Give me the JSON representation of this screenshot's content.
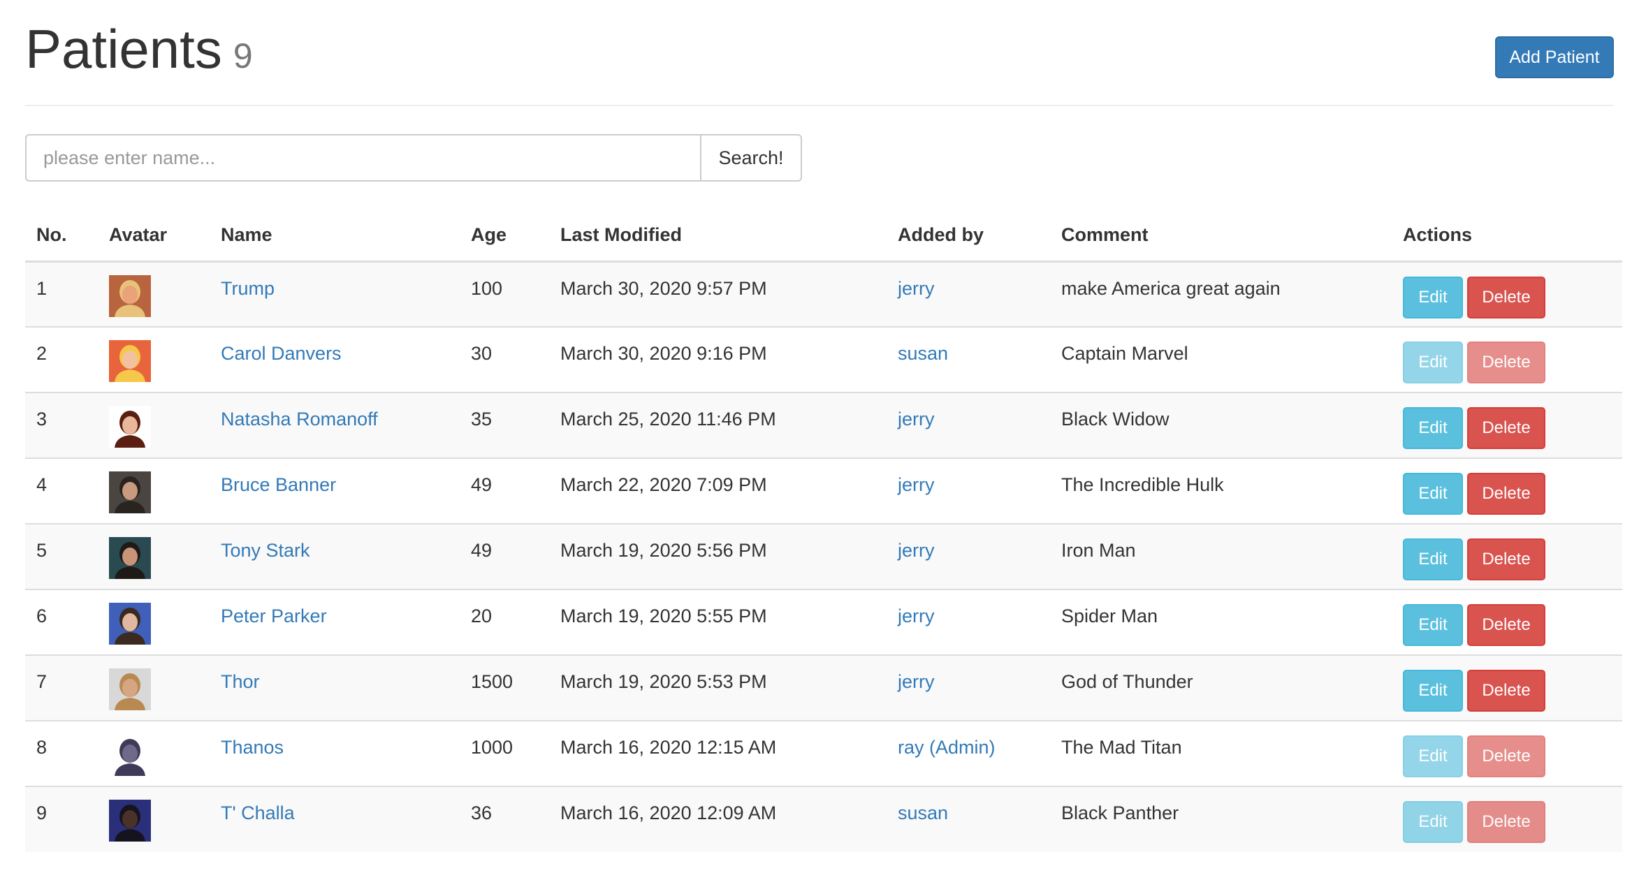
{
  "header": {
    "title": "Patients",
    "count": "9",
    "add_button": "Add Patient"
  },
  "search": {
    "placeholder": "please enter name...",
    "value": "",
    "button": "Search!"
  },
  "table": {
    "headers": [
      "No.",
      "Avatar",
      "Name",
      "Age",
      "Last Modified",
      "Added by",
      "Comment",
      "Actions"
    ],
    "edit_label": "Edit",
    "delete_label": "Delete",
    "rows": [
      {
        "no": "1",
        "name": "Trump",
        "age": "100",
        "modified": "March 30, 2020 9:57 PM",
        "added_by": "jerry",
        "comment": "make America great again",
        "enabled": true,
        "avatar": {
          "bg": "#b8643e",
          "skin": "#e9a27a",
          "hair": "#e8c17a"
        }
      },
      {
        "no": "2",
        "name": "Carol Danvers",
        "age": "30",
        "modified": "March 30, 2020 9:16 PM",
        "added_by": "susan",
        "comment": "Captain Marvel",
        "enabled": false,
        "avatar": {
          "bg": "#e8643c",
          "skin": "#f2c2a0",
          "hair": "#f5c84a"
        }
      },
      {
        "no": "3",
        "name": "Natasha Romanoff",
        "age": "35",
        "modified": "March 25, 2020 11:46 PM",
        "added_by": "jerry",
        "comment": "Black Widow",
        "enabled": true,
        "avatar": {
          "bg": "#ffffff",
          "skin": "#e9b79a",
          "hair": "#5a1e12"
        }
      },
      {
        "no": "4",
        "name": "Bruce Banner",
        "age": "49",
        "modified": "March 22, 2020 7:09 PM",
        "added_by": "jerry",
        "comment": "The Incredible Hulk",
        "enabled": true,
        "avatar": {
          "bg": "#4a4540",
          "skin": "#c89a80",
          "hair": "#2a2420"
        }
      },
      {
        "no": "5",
        "name": "Tony Stark",
        "age": "49",
        "modified": "March 19, 2020 5:56 PM",
        "added_by": "jerry",
        "comment": "Iron Man",
        "enabled": true,
        "avatar": {
          "bg": "#2a4a52",
          "skin": "#c99478",
          "hair": "#1e1a18"
        }
      },
      {
        "no": "6",
        "name": "Peter Parker",
        "age": "20",
        "modified": "March 19, 2020 5:55 PM",
        "added_by": "jerry",
        "comment": "Spider Man",
        "enabled": true,
        "avatar": {
          "bg": "#3f5fb8",
          "skin": "#e0b8a0",
          "hair": "#3a2a20"
        }
      },
      {
        "no": "7",
        "name": "Thor",
        "age": "1500",
        "modified": "March 19, 2020 5:53 PM",
        "added_by": "jerry",
        "comment": "God of Thunder",
        "enabled": true,
        "avatar": {
          "bg": "#d8d8d8",
          "skin": "#d6a584",
          "hair": "#b88a50"
        }
      },
      {
        "no": "8",
        "name": "Thanos",
        "age": "1000",
        "modified": "March 16, 2020 12:15 AM",
        "added_by": "ray (Admin)",
        "comment": "The Mad Titan",
        "enabled": false,
        "avatar": {
          "bg": "#ffffff",
          "skin": "#6e6a8a",
          "hair": "#3e3a58"
        }
      },
      {
        "no": "9",
        "name": "T' Challa",
        "age": "36",
        "modified": "March 16, 2020 12:09 AM",
        "added_by": "susan",
        "comment": "Black Panther",
        "enabled": false,
        "avatar": {
          "bg": "#2a2f7a",
          "skin": "#4a3228",
          "hair": "#15141e"
        }
      }
    ]
  },
  "colors": {
    "primary": "#337ab7",
    "info": "#5bc0de",
    "danger": "#d9534f",
    "link": "#337ab7"
  }
}
